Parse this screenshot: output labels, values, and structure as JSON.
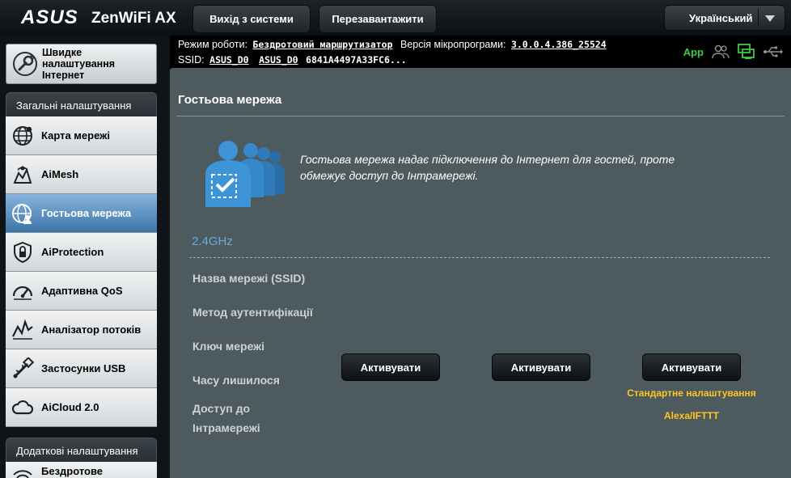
{
  "header": {
    "brand": "ASUS",
    "model": "ZenWiFi AX",
    "logout_label": "Вихід з системи",
    "reboot_label": "Перезавантажити",
    "language": "Український"
  },
  "info": {
    "mode_label": "Режим роботи:",
    "mode_value": "Бездротовий маршрутизатор",
    "firmware_label": "Версія мікропрограми:",
    "firmware_value": "3.0.0.4.386_25524",
    "ssid_label": "SSID:",
    "ssid_1": "ASUS_D0",
    "ssid_2": "ASUS_D0",
    "ssid_3": "6841A4497A33FC6...",
    "app_label": "App"
  },
  "sidebar": {
    "quick_setup": [
      "Швидке",
      "налаштування",
      "Інтернет"
    ],
    "general_header": "Загальні налаштування",
    "items": [
      {
        "label": "Карта мережі",
        "icon": "globe-icon"
      },
      {
        "label": "AiMesh",
        "icon": "aimesh-icon"
      },
      {
        "label": "Гостьова мережа",
        "icon": "guest-network-icon"
      },
      {
        "label": "AiProtection",
        "icon": "shield-icon"
      },
      {
        "label": "Адаптивна QoS",
        "icon": "gauge-icon"
      },
      {
        "label": "Аналізатор потоків",
        "icon": "traffic-analyzer-icon"
      },
      {
        "label": "Застосунки USB",
        "icon": "usb-icon"
      },
      {
        "label": "AiCloud 2.0",
        "icon": "cloud-icon"
      }
    ],
    "advanced_header": "Додаткові налаштування",
    "advanced_items": [
      {
        "label": "Бездротове",
        "icon": "wireless-icon"
      }
    ]
  },
  "main": {
    "title": "Гостьова мережа",
    "description": "Гостьова мережа надає підключення до Інтернет для гостей, проте обмежує доступ до Інтрамережі.",
    "band": "2.4GHz",
    "rows": [
      "Назва мережі (SSID)",
      "Метод аутентифікації",
      "Ключ мережі",
      "Часу лишилося",
      "Доступ до Інтрамережі"
    ],
    "activate_labels": [
      "Активувати",
      "Активувати",
      "Активувати"
    ],
    "default_settings_link": "Стандартне налаштування",
    "alexa_link": "Alexa/IFTTT"
  },
  "colors": {
    "accent_blue": "#6aa9d8",
    "link_yellow": "#ffc526",
    "panel_bg": "#4d5a5e",
    "active_menu": "#3b74a8"
  }
}
